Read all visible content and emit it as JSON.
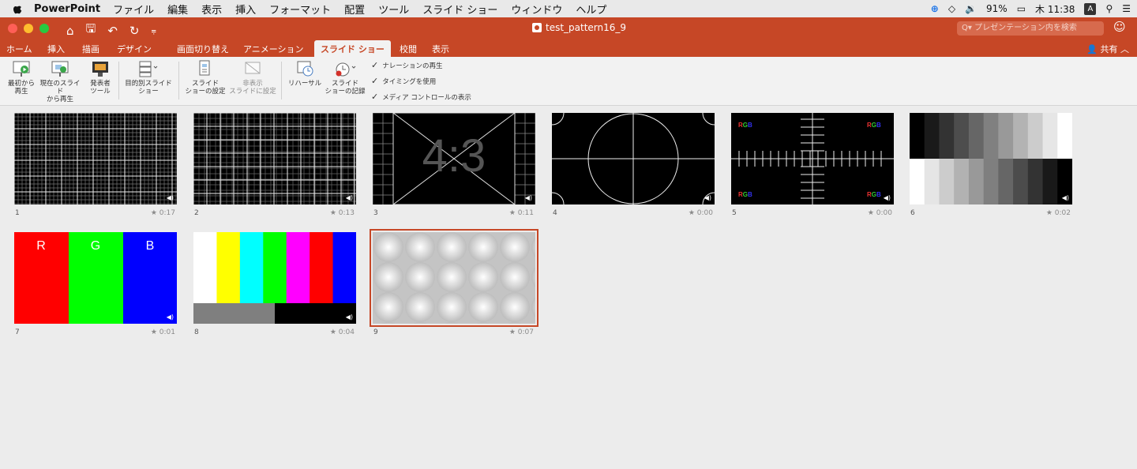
{
  "menubar": {
    "items": [
      "PowerPoint",
      "ファイル",
      "編集",
      "表示",
      "挿入",
      "フォーマット",
      "配置",
      "ツール",
      "スライド ショー",
      "ウィンドウ",
      "ヘルプ"
    ],
    "battery": "91%",
    "clock": "木 11:38",
    "input_mode": "A"
  },
  "window": {
    "title": "test_pattern16_9",
    "search_placeholder": "プレゼンテーション内を検索"
  },
  "tabs": [
    "ホーム",
    "挿入",
    "描画",
    "デザイン",
    "画面切り替え",
    "アニメーション",
    "スライド ショー",
    "校閲",
    "表示"
  ],
  "active_tab": "スライド ショー",
  "share_label": "共有",
  "ribbon": {
    "from_start": [
      "最初から",
      "再生"
    ],
    "from_current": [
      "現在のスライド",
      "から再生"
    ],
    "presenter": [
      "発表者",
      "ツール"
    ],
    "custom": [
      "目的別スライド",
      "ショー"
    ],
    "setup": [
      "スライド",
      "ショーの設定"
    ],
    "hide": [
      "非表示",
      "スライドに設定"
    ],
    "rehearse": "リハーサル",
    "record": [
      "スライド",
      "ショーの記録"
    ],
    "checks": [
      "ナレーションの再生",
      "タイミングを使用",
      "メディア コントロールの表示"
    ]
  },
  "slides": [
    {
      "num": "1",
      "time": "0:17"
    },
    {
      "num": "2",
      "time": "0:13"
    },
    {
      "num": "3",
      "time": "0:11",
      "text": "4:3"
    },
    {
      "num": "4",
      "time": "0:00"
    },
    {
      "num": "5",
      "time": "0:00",
      "text": "RGB"
    },
    {
      "num": "6",
      "time": "0:02"
    },
    {
      "num": "7",
      "time": "0:01",
      "labels": [
        "R",
        "G",
        "B"
      ]
    },
    {
      "num": "8",
      "time": "0:04"
    },
    {
      "num": "9",
      "time": "0:07"
    }
  ],
  "colors": {
    "accent": "#c64726"
  }
}
